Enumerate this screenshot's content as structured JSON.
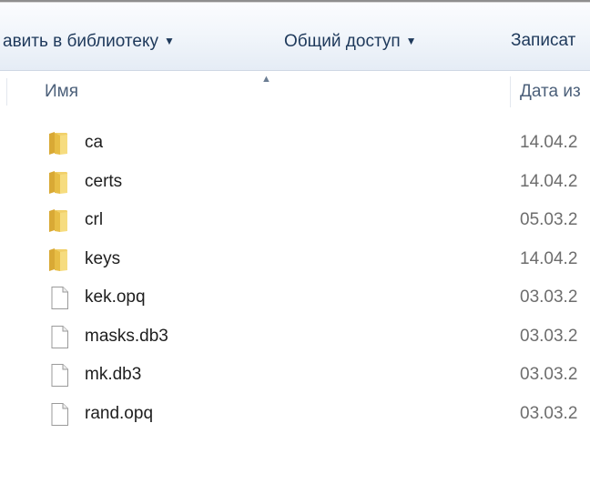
{
  "toolbar": {
    "library_label": "авить в библиотеку",
    "share_label": "Общий доступ",
    "burn_label": "Записат",
    "dropdown_glyph": "▼"
  },
  "columns": {
    "name_label": "Имя",
    "sort_glyph": "▲",
    "date_label": "Дата из"
  },
  "files": [
    {
      "name": "ca",
      "date": "14.04.2",
      "type": "folder"
    },
    {
      "name": "certs",
      "date": "14.04.2",
      "type": "folder"
    },
    {
      "name": "crl",
      "date": "05.03.2",
      "type": "folder"
    },
    {
      "name": "keys",
      "date": "14.04.2",
      "type": "folder"
    },
    {
      "name": "kek.opq",
      "date": "03.03.2",
      "type": "file"
    },
    {
      "name": "masks.db3",
      "date": "03.03.2",
      "type": "file"
    },
    {
      "name": "mk.db3",
      "date": "03.03.2",
      "type": "file"
    },
    {
      "name": "rand.opq",
      "date": "03.03.2",
      "type": "file"
    }
  ],
  "colors": {
    "toolbar_text": "#1e395b",
    "header_text": "#4c607a",
    "folder": "#e8c251"
  },
  "icons": {
    "folder": "folder-icon",
    "file": "file-icon"
  }
}
